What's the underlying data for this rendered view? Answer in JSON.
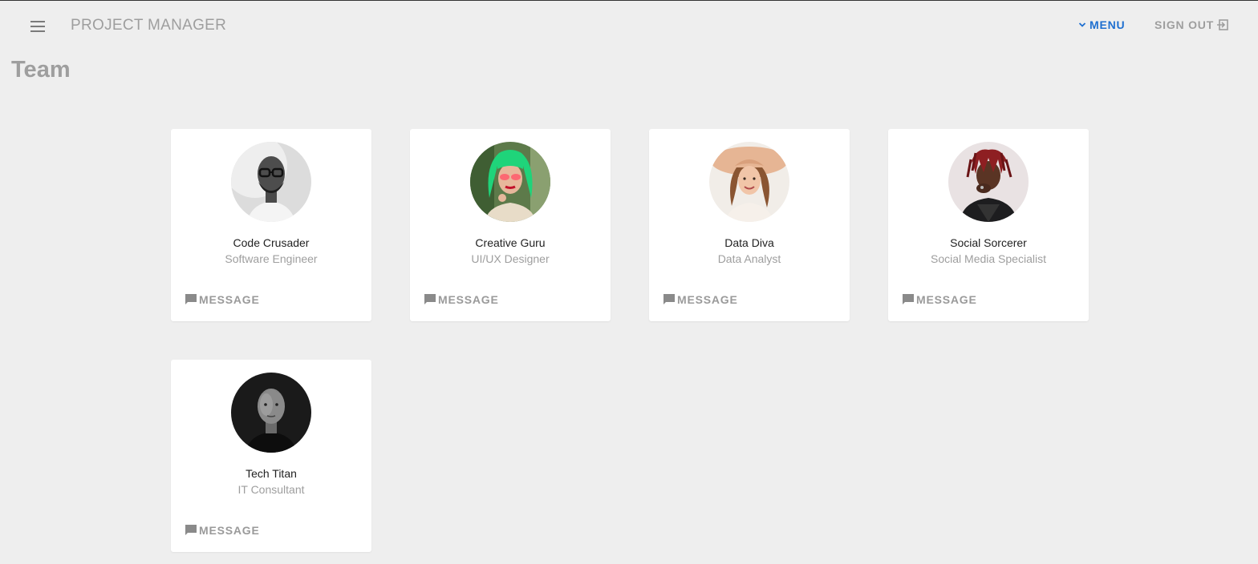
{
  "app": {
    "title": "PROJECT MANAGER",
    "menu_label": "MENU",
    "signout_label": "SIGN OUT"
  },
  "page": {
    "title": "Team"
  },
  "team": [
    {
      "name": "Code Crusader",
      "role": "Software Engineer",
      "action": "MESSAGE",
      "avatar_icon": "person-photo-icon"
    },
    {
      "name": "Creative Guru",
      "role": "UI/UX Designer",
      "action": "MESSAGE",
      "avatar_icon": "person-photo-icon"
    },
    {
      "name": "Data Diva",
      "role": "Data Analyst",
      "action": "MESSAGE",
      "avatar_icon": "person-photo-icon"
    },
    {
      "name": "Social Sorcerer",
      "role": "Social Media Specialist",
      "action": "MESSAGE",
      "avatar_icon": "person-photo-icon"
    },
    {
      "name": "Tech Titan",
      "role": "IT Consultant",
      "action": "MESSAGE",
      "avatar_icon": "person-photo-icon"
    }
  ],
  "colors": {
    "background": "#eeeeee",
    "accent": "#1e6fd0",
    "muted": "#9e9e9e",
    "card": "#ffffff"
  }
}
